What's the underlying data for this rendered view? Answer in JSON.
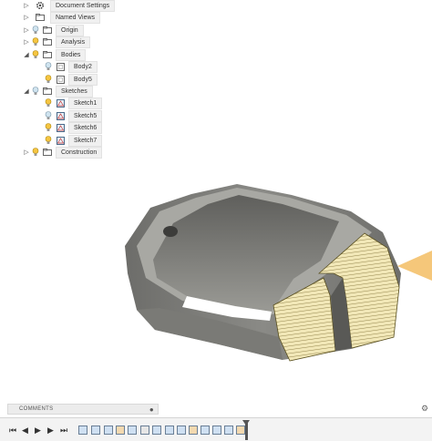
{
  "browser": {
    "items": [
      {
        "label": "Document Settings"
      },
      {
        "label": "Named Views"
      },
      {
        "label": "Origin"
      },
      {
        "label": "Analysis"
      },
      {
        "label": "Bodies"
      },
      {
        "label": "Body2"
      },
      {
        "label": "Body5"
      },
      {
        "label": "Sketches"
      },
      {
        "label": "Sketch1"
      },
      {
        "label": "Sketch5"
      },
      {
        "label": "Sketch6"
      },
      {
        "label": "Sketch7"
      },
      {
        "label": "Construction"
      }
    ]
  },
  "comments": {
    "label": "COMMENTS"
  },
  "icons": {
    "expand": "triangle-right-icon",
    "collapse": "triangle-down-icon",
    "visibility": "lightbulb-icon",
    "settings": "gear-icon"
  },
  "colors": {
    "model_gray": "#7d7d7a",
    "hatch_face": "#f0e6b4",
    "hatch_line": "#8c7a3a",
    "view_cube_accent": "#f5c77a"
  }
}
